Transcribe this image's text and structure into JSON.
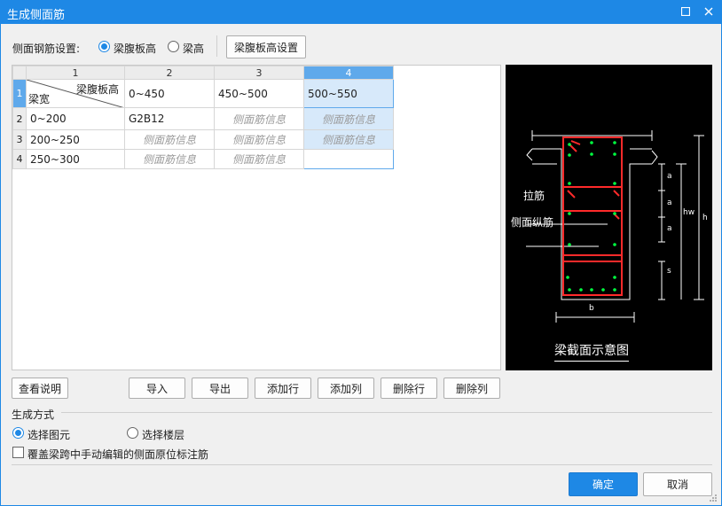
{
  "window": {
    "title": "生成侧面筋"
  },
  "settings": {
    "label": "侧面钢筋设置:",
    "options": [
      "梁腹板高",
      "梁高"
    ],
    "selected": "梁腹板高",
    "setup_button": "梁腹板高设置"
  },
  "grid": {
    "column_headers": [
      "1",
      "2",
      "3",
      "4"
    ],
    "row_headers": [
      "1",
      "2",
      "3",
      "4"
    ],
    "corner_top": "梁腹板高",
    "corner_bottom": "梁宽",
    "header_row": [
      "0~450",
      "450~500",
      "500~550"
    ],
    "rows": [
      {
        "width": "0~200",
        "cells": [
          "G2B12",
          "侧面筋信息",
          "侧面筋信息"
        ]
      },
      {
        "width": "200~250",
        "cells": [
          "侧面筋信息",
          "侧面筋信息",
          "侧面筋信息"
        ]
      },
      {
        "width": "250~300",
        "cells": [
          "侧面筋信息",
          "侧面筋信息",
          ""
        ]
      }
    ]
  },
  "diagram": {
    "caption": "梁截面示意图",
    "label_tie": "拉筋",
    "label_side": "侧面纵筋",
    "dim_a": "a",
    "dim_hw": "hw",
    "dim_h": "h",
    "dim_s": "s",
    "dim_b": "b"
  },
  "buttons": {
    "help": "查看说明",
    "import": "导入",
    "export": "导出",
    "add_row": "添加行",
    "add_col": "添加列",
    "del_row": "删除行",
    "del_col": "删除列",
    "ok": "确定",
    "cancel": "取消"
  },
  "generation": {
    "title": "生成方式",
    "options": [
      "选择图元",
      "选择楼层"
    ],
    "selected": "选择图元",
    "override_label": "覆盖梁跨中手动编辑的侧面原位标注筋"
  },
  "colors": {
    "accent": "#1e88e5",
    "rebar_red": "#ff2a2a",
    "rebar_dot": "#00ff40"
  }
}
